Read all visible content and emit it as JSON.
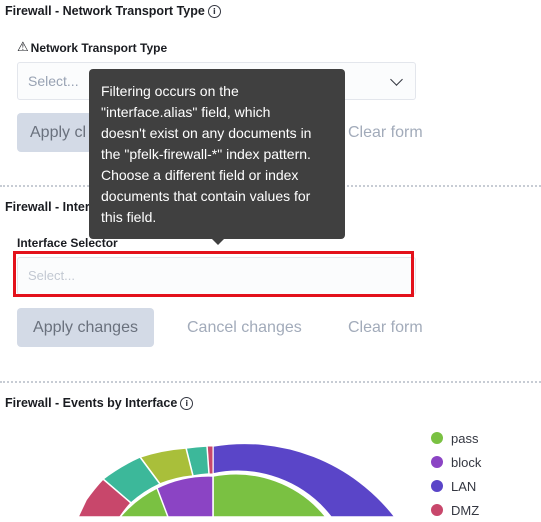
{
  "panel1": {
    "title": "Firewall - Network Transport Type",
    "field_label": "Network Transport Type",
    "select_placeholder": "Select...",
    "apply_label": "Apply cl",
    "clear_label": "Clear form"
  },
  "panel2": {
    "title": "Firewall - Inter",
    "field_label": "Interface Selector",
    "select_placeholder": "Select...",
    "apply_label": "Apply changes",
    "cancel_label": "Cancel changes",
    "clear_label": "Clear form"
  },
  "tooltip": {
    "text": "Filtering occurs on the\n\"interface.alias\" field, which\ndoesn't exist on any documents in\nthe \"pfelk-firewall-*\" index pattern.\nChoose a different field or index\ndocuments that contain values for\nthis field."
  },
  "panel3": {
    "title": "Firewall - Events by Interface"
  },
  "legend": {
    "items": [
      {
        "label": "pass",
        "color": "#7ac142"
      },
      {
        "label": "block",
        "color": "#8b44c4"
      },
      {
        "label": "LAN",
        "color": "#5a45c8"
      },
      {
        "label": "DMZ",
        "color": "#c8476b"
      }
    ]
  },
  "colors": {
    "accent_red": "#e3111b",
    "tooltip_bg": "#404040"
  }
}
